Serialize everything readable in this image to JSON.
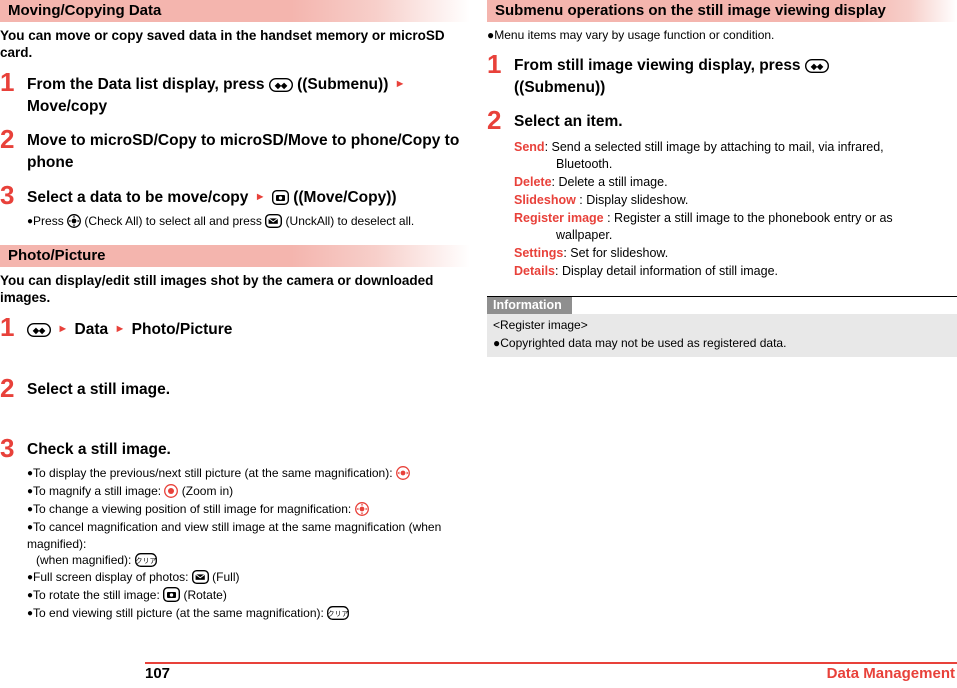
{
  "left": {
    "section1": {
      "heading": "Moving/Copying Data",
      "intro": "You can move or copy saved data in the handset memory or microSD card.",
      "steps": [
        {
          "num": "1",
          "title_a": "From the Data list display, press",
          "title_b": "(Submenu)",
          "title_c": "Move/copy"
        },
        {
          "num": "2",
          "title_a": "Move to microSD/Copy to microSD/Move to phone/Copy to phone"
        },
        {
          "num": "3",
          "title_a": "Select a data to be move/copy",
          "title_b": "(Move/Copy)",
          "bullets": [
            {
              "pre": "Press",
              "mid": "(Check All) to select all and press",
              "post": "(UnckAll) to deselect all."
            }
          ]
        }
      ]
    },
    "section2": {
      "heading": "Photo/Picture",
      "intro": "You can display/edit still images shot by the camera or downloaded images.",
      "steps": [
        {
          "num": "1",
          "title_a": "Data",
          "title_b": "Photo/Picture"
        },
        {
          "num": "2",
          "title_a": "Select a still image."
        },
        {
          "num": "3",
          "title_a": "Check a still image.",
          "bullets": [
            {
              "text": "To display the previous/next still picture (at the same magnification):"
            },
            {
              "text": "To magnify a still image:",
              "suffix": "(Zoom in)"
            },
            {
              "text": "To change a viewing position of still image for magnification:"
            },
            {
              "text": "To cancel magnification and view still image at the same magnification (when magnified):"
            },
            {
              "text": "Full screen display of photos:",
              "suffix": "(Full)"
            },
            {
              "text": "To rotate the still image:",
              "suffix": "(Rotate)"
            },
            {
              "text": "To end viewing still picture (at the same magnification):"
            }
          ]
        }
      ]
    }
  },
  "right": {
    "heading": "Submenu operations on the still image viewing display",
    "note": "Menu items may vary by usage function or condition.",
    "steps": [
      {
        "num": "1",
        "title_a": "From still image viewing display, press",
        "title_b": "(Submenu)"
      },
      {
        "num": "2",
        "title_a": "Select an item."
      }
    ],
    "items": [
      {
        "term": "Send",
        "desc": ": Send a selected still image by attaching to mail, via infrared,",
        "desc2": "Bluetooth."
      },
      {
        "term": "Delete",
        "desc": ": Delete a still image."
      },
      {
        "term": "Slideshow",
        "desc": " : Display slideshow."
      },
      {
        "term": "Register image",
        "desc": " : Register a still image to the phonebook entry or as",
        "desc2": "wallpaper."
      },
      {
        "term": "Settings",
        "desc": ": Set for slideshow."
      },
      {
        "term": "Details",
        "desc": ": Display detail information of still image."
      }
    ],
    "information": {
      "title": "Information",
      "subtitle": "<Register image>",
      "body": "Copyrighted data may not be used as registered data."
    }
  },
  "footer": {
    "page": "107",
    "section": "Data Management"
  },
  "colors": {
    "accent_red": "#e8413a",
    "header_pink": "#f4b5ae",
    "info_gray": "#8f8f8f",
    "info_body": "#e8e8e8"
  },
  "icons": {
    "submenu": "submenu-key-icon",
    "camera": "camera-key-icon",
    "tv": "tv-key-icon",
    "mail": "mail-key-icon",
    "clear": "clear-key-icon",
    "multi_lr": "multi-cursor-lr-icon",
    "multi_all": "multi-cursor-all-icon",
    "center": "center-key-icon"
  }
}
